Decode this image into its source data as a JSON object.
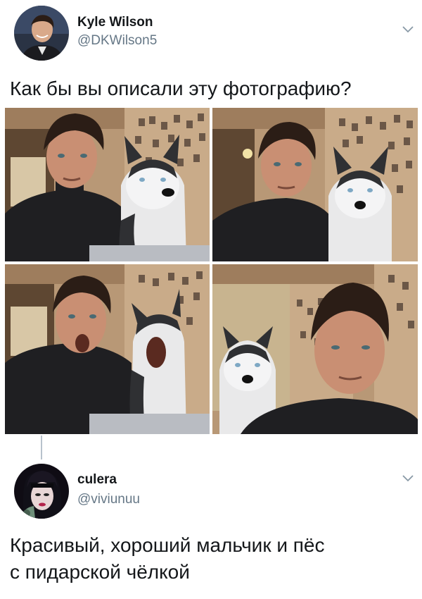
{
  "tweets": [
    {
      "author": {
        "name": "Kyle Wilson",
        "handle": "@DKWilson5",
        "avatar_icon": "man-avatar"
      },
      "text": "Как бы вы описали эту фотографию?",
      "photos": [
        {
          "icon": "man-and-husky-photo",
          "expression": "neutral"
        },
        {
          "icon": "man-and-husky-photo",
          "expression": "neutral"
        },
        {
          "icon": "man-and-husky-photo",
          "expression": "mouths-open"
        },
        {
          "icon": "man-and-husky-photo",
          "expression": "closeup"
        }
      ],
      "menu_icon": "chevron-down-icon"
    },
    {
      "author": {
        "name": "culera",
        "handle": "@viviunuu",
        "avatar_icon": "woman-avatar"
      },
      "text_lines": [
        "Красивый, хороший мальчик и пёс",
        "с пидарской чёлкой"
      ],
      "menu_icon": "chevron-down-icon"
    }
  ],
  "colors": {
    "name": "#14171a",
    "handle": "#657786",
    "thread_line": "#b8c2cc",
    "chevron": "#8899a6"
  }
}
